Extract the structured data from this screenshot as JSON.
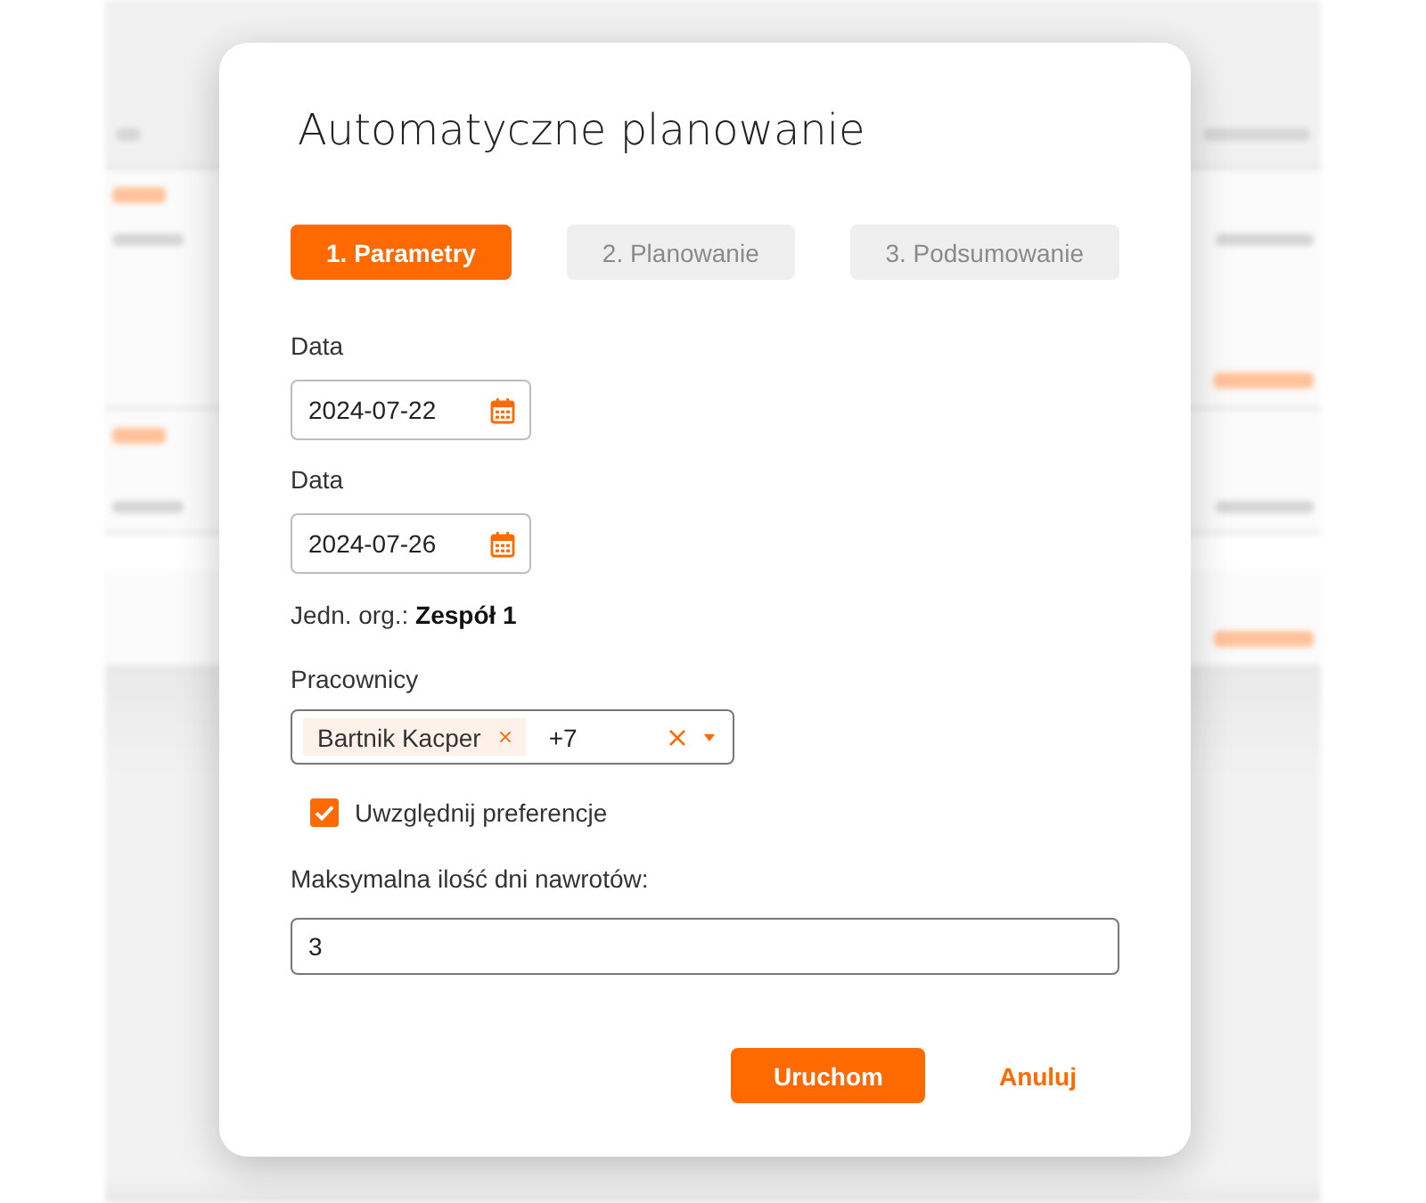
{
  "dialog": {
    "title": "Automatyczne planowanie",
    "steps": [
      {
        "label": "1. Parametry",
        "selected": true
      },
      {
        "label": "2. Planowanie",
        "selected": false
      },
      {
        "label": "3. Podsumowanie",
        "selected": false
      }
    ],
    "fields": [
      {
        "kind": "date",
        "label": "Data",
        "value": "2024-07-22"
      },
      {
        "kind": "date",
        "label": "Data",
        "value": "2024-07-26"
      },
      {
        "kind": "info",
        "text": "Jedn. org.: **Zespół 1**"
      },
      {
        "kind": "multiselect",
        "label": "Pracownicy",
        "chips": [
          "Bartnik Kacper"
        ],
        "more": "+7"
      },
      {
        "kind": "checkbox",
        "label": "Uwzględnij preferencje",
        "checked": true
      },
      {
        "kind": "text",
        "label": "Maksymalna ilość dni nawrotów:",
        "value": "3"
      }
    ],
    "buttons": [
      {
        "kind": "primary",
        "label": "Uruchom"
      },
      {
        "kind": "link",
        "label": "Anuluj"
      }
    ]
  }
}
